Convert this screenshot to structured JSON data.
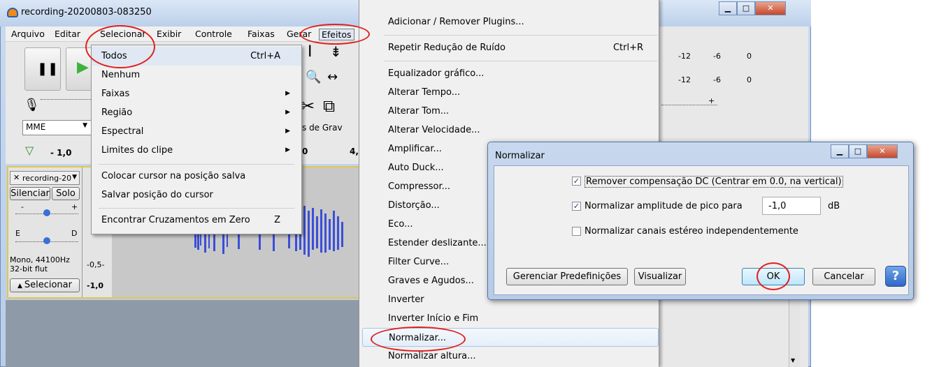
{
  "window": {
    "title": "recording-20200803-083250"
  },
  "menubar": {
    "items": [
      "Arquivo",
      "Editar",
      "Selecionar",
      "Exibir",
      "Controle",
      "Faixas",
      "Gerar",
      "Efeitos"
    ]
  },
  "toolbar": {
    "host_select": "MME",
    "rec_device": "s de Grav",
    "zoom_value": "- 1,0",
    "ruler_left": "0",
    "ruler_right": "4,"
  },
  "track": {
    "name": "recording-20",
    "mute_label": "Silenciar",
    "solo_label": "Solo",
    "gain_minus": "-",
    "gain_plus": "+",
    "pan_left": "E",
    "pan_right": "D",
    "info_line1": "Mono, 44100Hz",
    "info_line2": "32-bit flut",
    "select_label": "Selecionar",
    "scale_mid": "-0,5-",
    "scale_bottom": "-1,0"
  },
  "meters": {
    "ticks": [
      "-12",
      "-6",
      "0"
    ],
    "ticks2": [
      "-12",
      "-6",
      "0"
    ],
    "plus": "+"
  },
  "select_menu": {
    "items": [
      {
        "label": "Todos",
        "shortcut": "Ctrl+A"
      },
      {
        "label": "Nenhum",
        "shortcut": ""
      },
      {
        "label": "Faixas",
        "shortcut": ""
      },
      {
        "label": "Região",
        "shortcut": ""
      },
      {
        "label": "Espectral",
        "shortcut": ""
      },
      {
        "label": "Limites do clipe",
        "shortcut": ""
      },
      {
        "label": "Colocar cursor na posição salva",
        "shortcut": ""
      },
      {
        "label": "Salvar posição do cursor",
        "shortcut": ""
      },
      {
        "label": "Encontrar Cruzamentos em Zero",
        "shortcut": "Z"
      }
    ]
  },
  "effects_menu": {
    "items": [
      {
        "label": "Adicionar / Remover Plugins...",
        "shortcut": ""
      },
      {
        "label": "Repetir Redução de Ruído",
        "shortcut": "Ctrl+R"
      },
      {
        "label": "Equalizador gráfico...",
        "shortcut": ""
      },
      {
        "label": "Alterar Tempo...",
        "shortcut": ""
      },
      {
        "label": "Alterar Tom...",
        "shortcut": ""
      },
      {
        "label": "Alterar Velocidade...",
        "shortcut": ""
      },
      {
        "label": "Amplificar...",
        "shortcut": ""
      },
      {
        "label": "Auto Duck...",
        "shortcut": ""
      },
      {
        "label": "Compressor...",
        "shortcut": ""
      },
      {
        "label": "Distorção...",
        "shortcut": ""
      },
      {
        "label": "Eco...",
        "shortcut": ""
      },
      {
        "label": "Estender deslizante...",
        "shortcut": ""
      },
      {
        "label": "Filter Curve...",
        "shortcut": ""
      },
      {
        "label": "Graves e Agudos...",
        "shortcut": ""
      },
      {
        "label": "Inverter",
        "shortcut": ""
      },
      {
        "label": "Inverter Início e Fim",
        "shortcut": ""
      },
      {
        "label": "Normalizar...",
        "shortcut": ""
      },
      {
        "label": "Normalizar altura...",
        "shortcut": ""
      }
    ]
  },
  "dialog": {
    "title": "Normalizar",
    "opt_dc": "Remover compensação DC (Centrar em 0.0, na vertical)",
    "opt_peak": "Normalizar amplitude de pico para",
    "peak_value": "-1,0",
    "peak_unit": "dB",
    "opt_stereo": "Normalizar canais estéreo independentemente",
    "btn_presets": "Gerenciar Predefinições",
    "btn_preview": "Visualizar",
    "btn_ok": "OK",
    "btn_cancel": "Cancelar",
    "btn_help": "?"
  },
  "colors": {
    "annotation": "#e0201e",
    "waveform": "#3b4fd8",
    "track_border": "#e0c84a"
  }
}
